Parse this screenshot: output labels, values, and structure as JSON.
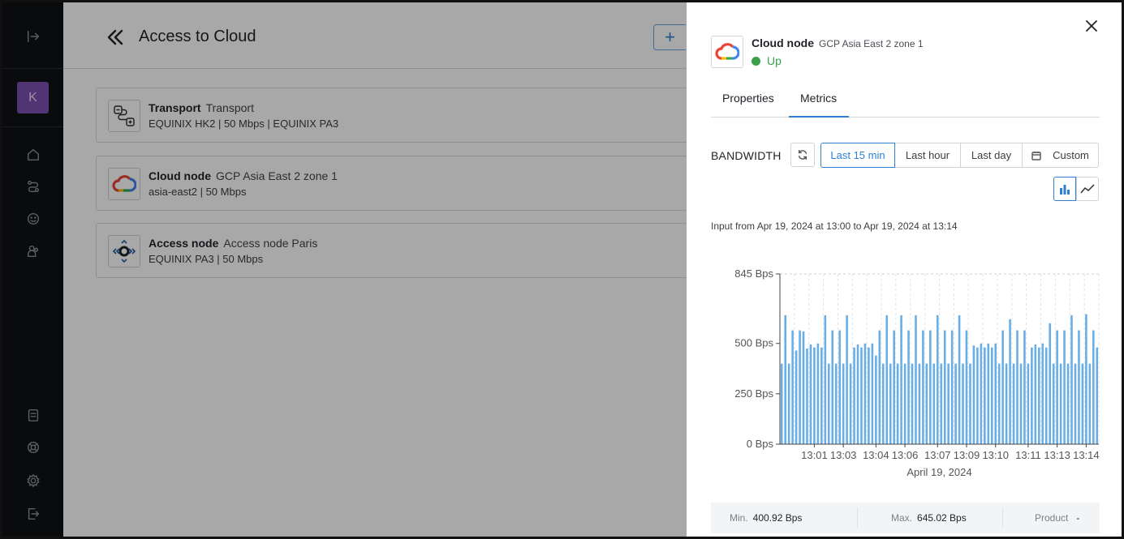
{
  "page": {
    "title": "Access to Cloud",
    "add_label": "+"
  },
  "user": {
    "initial": "K"
  },
  "cards": [
    {
      "title": "Transport",
      "name": "Transport",
      "subtitle": "EQUINIX HK2  |  50 Mbps  |  EQUINIX PA3",
      "icon": "transport-icon"
    },
    {
      "title": "Cloud node",
      "name": "GCP Asia East 2 zone 1",
      "subtitle": "asia-east2  |  50 Mbps",
      "icon": "gcp-cloud-icon"
    },
    {
      "title": "Access node",
      "name": "Access node Paris",
      "subtitle": "EQUINIX PA3  |  50 Mbps",
      "icon": "access-node-icon"
    }
  ],
  "drawer": {
    "title": "Cloud node",
    "name": "GCP Asia East 2 zone 1",
    "status": "Up",
    "status_color": "#3aa04a",
    "tabs": [
      {
        "label": "Properties",
        "active": false
      },
      {
        "label": "Metrics",
        "active": true
      }
    ],
    "section_label": "BANDWIDTH",
    "ranges": [
      {
        "label": "Last 15 min",
        "active": true
      },
      {
        "label": "Last hour",
        "active": false
      },
      {
        "label": "Last day",
        "active": false
      },
      {
        "label": "Custom",
        "active": false
      }
    ],
    "chart_types": [
      {
        "icon": "bar-chart-icon",
        "active": true
      },
      {
        "icon": "line-chart-icon",
        "active": false
      }
    ],
    "range_text": "Input from Apr 19, 2024 at 13:00 to Apr 19, 2024 at 13:14",
    "stats": {
      "min_label": "Min.",
      "min_value": "400.92 Bps",
      "max_label": "Max.",
      "max_value": "645.02 Bps",
      "product_label": "Product",
      "product_value": "-"
    }
  },
  "chart_data": {
    "type": "bar",
    "xlabel": "April 19, 2024",
    "ylabel": "",
    "ylim": [
      0,
      845
    ],
    "y_ticks": [
      {
        "value": 0,
        "label": "0 Bps"
      },
      {
        "value": 250,
        "label": "250 Bps"
      },
      {
        "value": 500,
        "label": "500 Bps"
      },
      {
        "value": 845,
        "label": "845 Bps"
      }
    ],
    "x_ticks": [
      {
        "index": 9,
        "label": "13:01"
      },
      {
        "index": 17,
        "label": "13:03"
      },
      {
        "index": 26,
        "label": "13:04"
      },
      {
        "index": 34,
        "label": "13:06"
      },
      {
        "index": 43,
        "label": "13:07"
      },
      {
        "index": 51,
        "label": "13:09"
      },
      {
        "index": 59,
        "label": "13:10"
      },
      {
        "index": 68,
        "label": "13:11"
      },
      {
        "index": 76,
        "label": "13:13"
      },
      {
        "index": 84,
        "label": "13:14"
      }
    ],
    "grid": true,
    "color": "#6aaee6",
    "values": [
      400,
      640,
      400,
      565,
      465,
      565,
      560,
      475,
      495,
      480,
      500,
      480,
      640,
      400,
      565,
      400,
      565,
      400,
      640,
      400,
      480,
      495,
      480,
      500,
      480,
      500,
      440,
      565,
      400,
      640,
      400,
      565,
      400,
      640,
      400,
      565,
      400,
      640,
      400,
      565,
      400,
      565,
      400,
      640,
      400,
      565,
      400,
      565,
      400,
      640,
      400,
      565,
      400,
      490,
      480,
      500,
      480,
      500,
      480,
      500,
      400,
      565,
      400,
      620,
      400,
      565,
      400,
      565,
      400,
      480,
      495,
      480,
      500,
      480,
      600,
      400,
      565,
      400,
      565,
      400,
      640,
      400,
      565,
      400,
      645,
      400,
      565,
      480
    ]
  }
}
